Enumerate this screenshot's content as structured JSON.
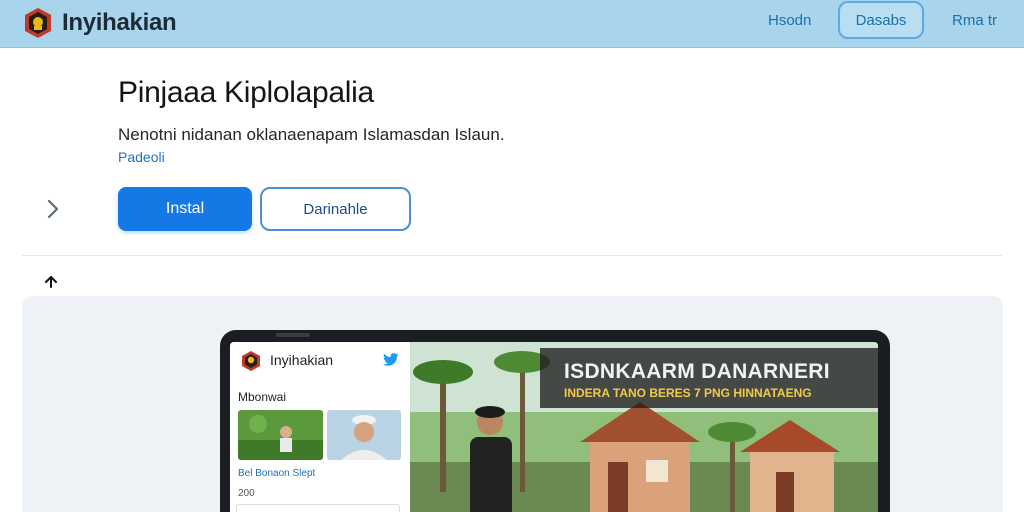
{
  "header": {
    "brand_name": "Inyihakian",
    "nav": [
      {
        "label": "Hsodn"
      },
      {
        "label": "Dasabs"
      },
      {
        "label": "Rma tr"
      }
    ]
  },
  "main": {
    "title": "Pinjaaa Kiplolapalia",
    "description": "Nenotni nidanan oklanaenapam Islamasdan Islaun.",
    "sub_link": "Padeoli",
    "install_label": "Instal",
    "secondary_label": "Darinahle"
  },
  "preview": {
    "app_name": "Inyihakian",
    "section_title": "Mbonwai",
    "caption": "Bel Bonaon Slept",
    "count": "200",
    "banner_line1": "ISDNKAARM DANARNERI",
    "banner_line2": "INDERA TANO BERES 7 PNG HINNATAENG"
  },
  "colors": {
    "topbar": "#a8d4ec",
    "primary": "#1479e5",
    "link": "#1f73c4"
  },
  "icons": [
    "brand-logo-icon",
    "chevron-right-icon",
    "arrow-up-icon",
    "twitter-icon"
  ]
}
